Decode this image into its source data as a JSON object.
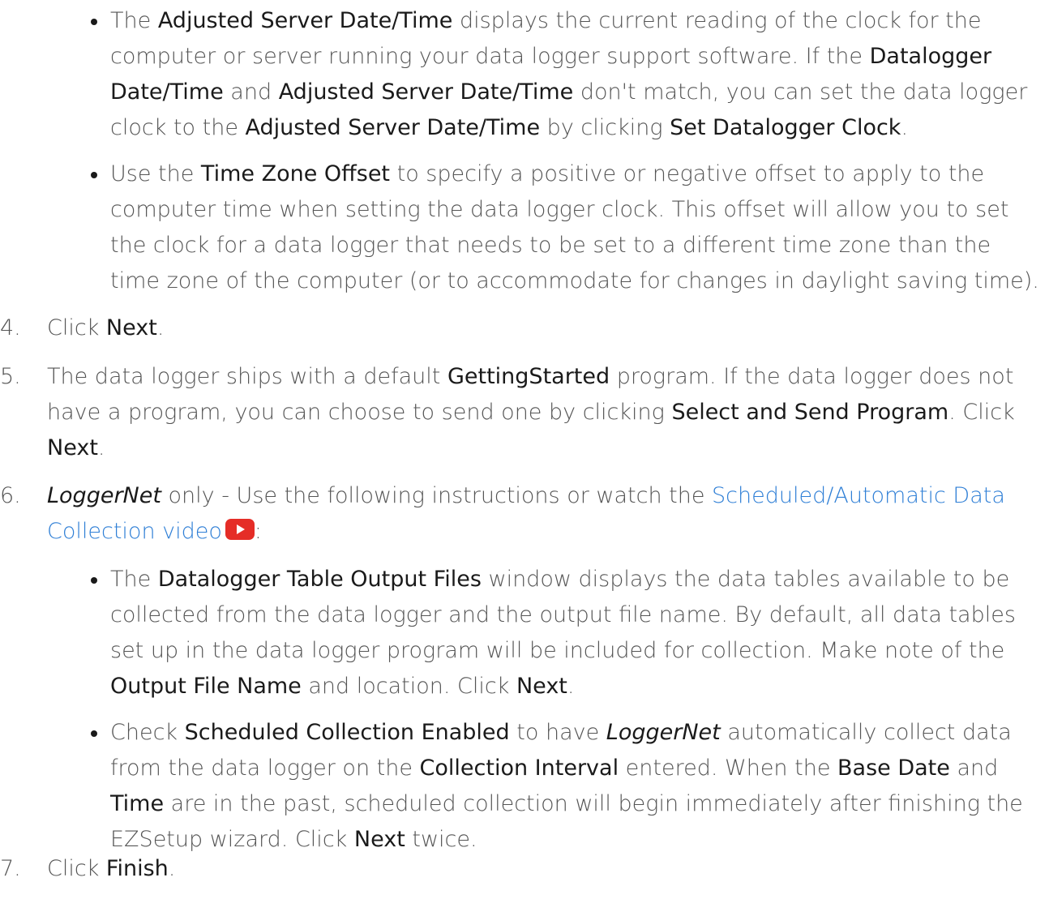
{
  "bullets_top": [
    {
      "parts": [
        {
          "t": "The ",
          "s": "n"
        },
        {
          "t": "Adjusted Server Date/Time",
          "s": "k"
        },
        {
          "t": " displays the current reading of the clock for the computer or server running your data logger support software. If the ",
          "s": "n"
        },
        {
          "t": "Datalogger Date/Time",
          "s": "k"
        },
        {
          "t": " and ",
          "s": "n"
        },
        {
          "t": "Adjusted Server Date/Time",
          "s": "k"
        },
        {
          "t": " don't match, you can set the data logger clock to the ",
          "s": "n"
        },
        {
          "t": "Adjusted Server Date/Time",
          "s": "k"
        },
        {
          "t": " by clicking ",
          "s": "n"
        },
        {
          "t": "Set Datalogger Clock",
          "s": "k"
        },
        {
          "t": ".",
          "s": "n"
        }
      ]
    },
    {
      "parts": [
        {
          "t": "Use the ",
          "s": "n"
        },
        {
          "t": "Time Zone Offset",
          "s": "k"
        },
        {
          "t": " to specify a positive or negative offset to apply to the computer time when setting the data logger clock. This offset will allow you to set the clock for a data logger that needs to be set to a different time zone than the time zone of the computer (or to accommodate for changes in daylight saving time).",
          "s": "n"
        }
      ]
    }
  ],
  "steps": [
    {
      "num": "4.",
      "parts": [
        {
          "t": "Click ",
          "s": "n"
        },
        {
          "t": "Next",
          "s": "k"
        },
        {
          "t": ".",
          "s": "n"
        }
      ]
    },
    {
      "num": "5.",
      "parts": [
        {
          "t": "The data logger ships with a default ",
          "s": "n"
        },
        {
          "t": "GettingStarted",
          "s": "k"
        },
        {
          "t": " program. If the data logger does not have a program, you can choose to send one by clicking ",
          "s": "n"
        },
        {
          "t": "Select and Send Program",
          "s": "k"
        },
        {
          "t": ". Click ",
          "s": "n"
        },
        {
          "t": "Next",
          "s": "k"
        },
        {
          "t": ".",
          "s": "n"
        }
      ]
    },
    {
      "num": "6.",
      "parts": [
        {
          "t": "LoggerNet",
          "s": "i"
        },
        {
          "t": " only - Use the following instructions or watch the ",
          "s": "n"
        },
        {
          "t": "Scheduled/Automatic Data Collection video",
          "s": "l"
        },
        {
          "t": "",
          "s": "yt"
        },
        {
          "t": ":",
          "s": "n"
        }
      ]
    },
    {
      "num": "7.",
      "parts": [
        {
          "t": "Click ",
          "s": "n"
        },
        {
          "t": "Finish",
          "s": "k"
        },
        {
          "t": ".",
          "s": "n"
        }
      ]
    }
  ],
  "bullets_step6": [
    {
      "parts": [
        {
          "t": "The ",
          "s": "n"
        },
        {
          "t": "Datalogger Table Output Files",
          "s": "k"
        },
        {
          "t": " window displays the data tables available to be collected from the data logger and the output file name. By default, all data tables set up in the data logger program will be included for collection. Make note of the ",
          "s": "n"
        },
        {
          "t": "Output File Name",
          "s": "k"
        },
        {
          "t": " and location. Click ",
          "s": "n"
        },
        {
          "t": "Next",
          "s": "k"
        },
        {
          "t": ".",
          "s": "n"
        }
      ]
    },
    {
      "parts": [
        {
          "t": "Check ",
          "s": "n"
        },
        {
          "t": "Scheduled Collection Enabled",
          "s": "k"
        },
        {
          "t": " to have ",
          "s": "n"
        },
        {
          "t": "LoggerNet",
          "s": "i"
        },
        {
          "t": " automatically collect data from the data logger on the ",
          "s": "n"
        },
        {
          "t": "Collection Interval",
          "s": "k"
        },
        {
          "t": " entered. When the ",
          "s": "n"
        },
        {
          "t": "Base Date",
          "s": "k"
        },
        {
          "t": " and ",
          "s": "n"
        },
        {
          "t": "Time",
          "s": "k"
        },
        {
          "t": " are in the past, scheduled collection will begin immediately after finishing the EZSetup wizard. Click ",
          "s": "n"
        },
        {
          "t": "Next",
          "s": "k"
        },
        {
          "t": " twice.",
          "s": "n"
        }
      ]
    }
  ],
  "colors": {
    "text": "#555555",
    "keyword": "#1a1a1a",
    "link": "#2f7fd6",
    "youtube": "#e52d27"
  },
  "icons": {
    "video": "youtube-play-icon"
  }
}
